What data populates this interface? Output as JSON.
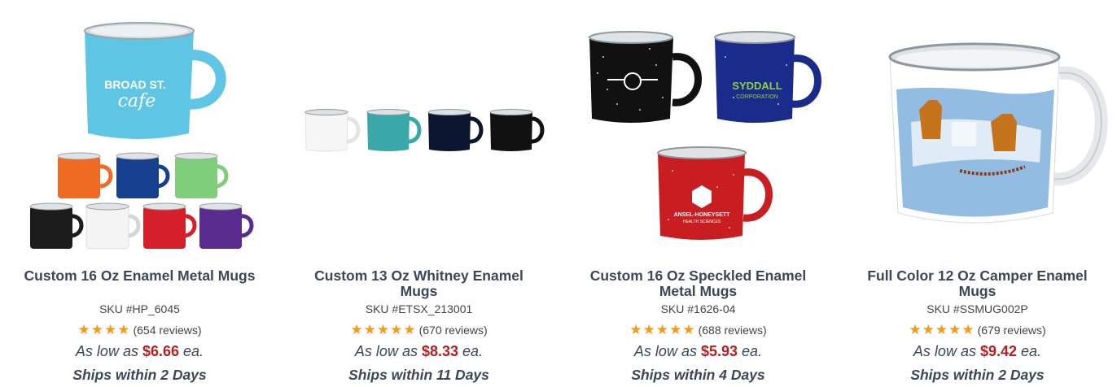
{
  "products": [
    {
      "title": "Custom 16 Oz Enamel Metal Mugs",
      "sku": "SKU #HP_6045",
      "stars": 4,
      "reviews": "(654 reviews)",
      "price_prefix": "As low as",
      "price": "$6.66",
      "price_suffix": "ea.",
      "ships": "Ships within 2 Days",
      "image": {
        "logo_line1": "BROAD ST.",
        "logo_line2": "cafe",
        "colors": [
          "#5ec6e4",
          "#ef6b24",
          "#163f8e",
          "#7fce7c",
          "#1b1b1b",
          "#f4f4f4",
          "#d5202a",
          "#5a2c8f"
        ]
      }
    },
    {
      "title": "Custom 13 Oz Whitney Enamel Mugs",
      "sku": "SKU #ETSX_213001",
      "stars": 5,
      "reviews": "(670 reviews)",
      "price_prefix": "As low as",
      "price": "$8.33",
      "price_suffix": "ea.",
      "ships": "Ships within 11 Days",
      "image": {
        "colors": [
          "#f6f6f6",
          "#3aa8a8",
          "#0d1630",
          "#111111"
        ]
      }
    },
    {
      "title": "Custom 16 Oz Speckled Enamel Metal Mugs",
      "sku": "SKU #1626-04",
      "stars": 5,
      "reviews": "(688 reviews)",
      "price_prefix": "As low as",
      "price": "$5.93",
      "price_suffix": "ea.",
      "ships": "Ships within 4 Days",
      "image": {
        "logo_blue_line1": "SYDDALL",
        "logo_blue_line2": "CORPORATION",
        "logo_red_line1": "ANSEL-HONEYSETT",
        "logo_red_line2": "HEALTH SCIENCES",
        "colors": [
          "#111111",
          "#1a2b8c",
          "#c81e22"
        ]
      }
    },
    {
      "title": "Full Color 12 Oz Camper Enamel Mugs",
      "sku": "SKU #SSMUG002P",
      "stars": 5,
      "reviews": "(679 reviews)",
      "price_prefix": "As low as",
      "price": "$9.42",
      "price_suffix": "ea.",
      "ships": "Ships within 2 Days",
      "image": {
        "colors": [
          "#ffffff",
          "#6fa6d8",
          "#c5741c"
        ]
      }
    }
  ]
}
